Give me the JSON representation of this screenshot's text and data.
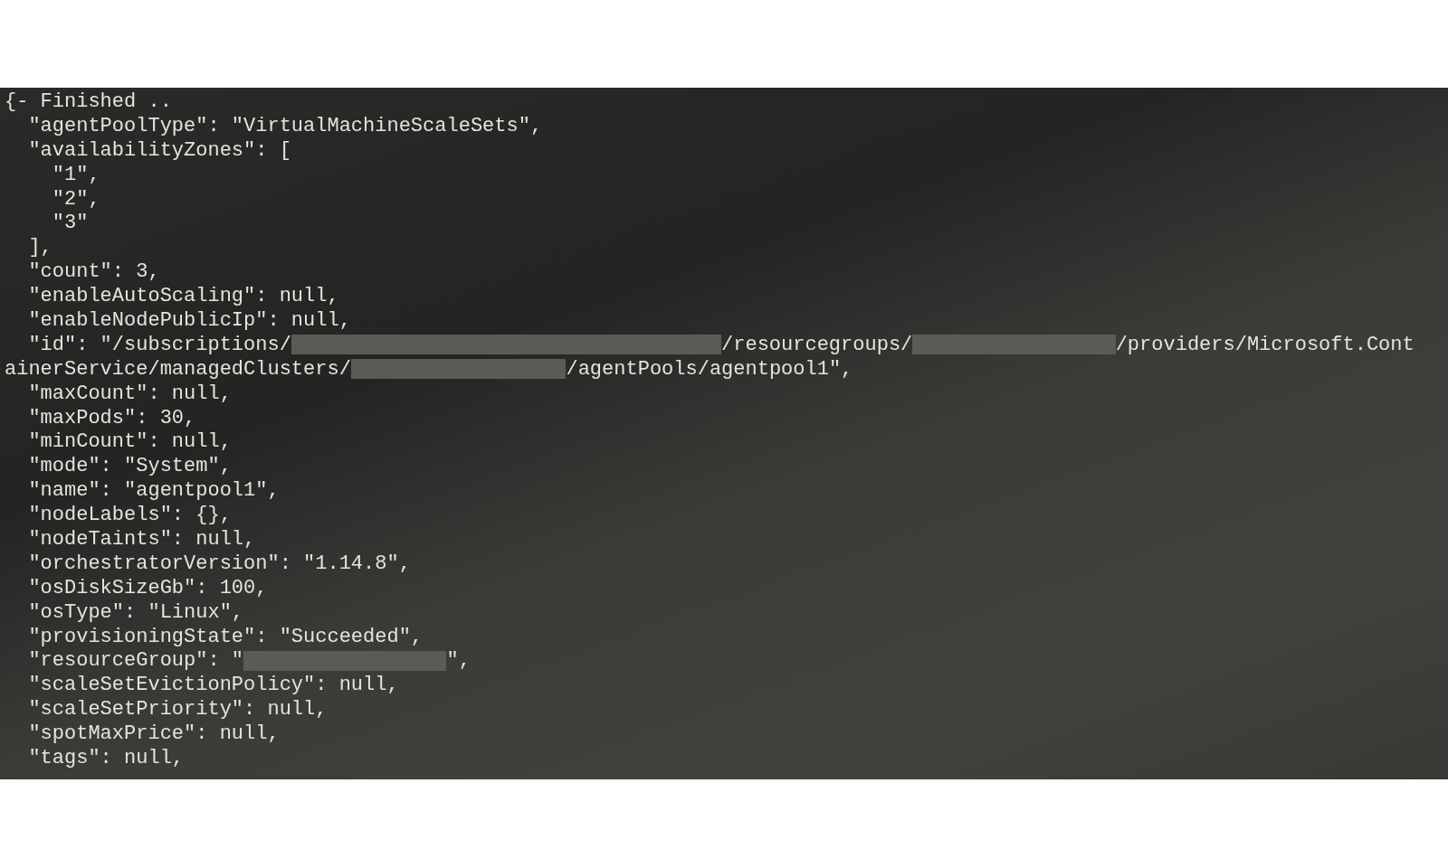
{
  "terminal": {
    "lines": [
      [
        {
          "kind": "text",
          "text": "{- Finished .."
        }
      ],
      [
        {
          "kind": "text",
          "text": "  \"agentPoolType\": \"VirtualMachineScaleSets\","
        }
      ],
      [
        {
          "kind": "text",
          "text": "  \"availabilityZones\": ["
        }
      ],
      [
        {
          "kind": "text",
          "text": "    \"1\","
        }
      ],
      [
        {
          "kind": "text",
          "text": "    \"2\","
        }
      ],
      [
        {
          "kind": "text",
          "text": "    \"3\""
        }
      ],
      [
        {
          "kind": "text",
          "text": "  ],"
        }
      ],
      [
        {
          "kind": "text",
          "text": "  \"count\": 3,"
        }
      ],
      [
        {
          "kind": "text",
          "text": "  \"enableAutoScaling\": null,"
        }
      ],
      [
        {
          "kind": "text",
          "text": "  \"enableNodePublicIp\": null,"
        }
      ],
      [
        {
          "kind": "text",
          "text": "  \"id\": \"/subscriptions/"
        },
        {
          "kind": "redacted"
        },
        {
          "kind": "text",
          "text": "/resourcegroups/"
        },
        {
          "kind": "redacted"
        },
        {
          "kind": "text",
          "text": "/providers/Microsoft.Cont"
        }
      ],
      [
        {
          "kind": "text",
          "text": "ainerService/managedClusters/"
        },
        {
          "kind": "redacted"
        },
        {
          "kind": "text",
          "text": "/agentPools/agentpool1\","
        }
      ],
      [
        {
          "kind": "text",
          "text": "  \"maxCount\": null,"
        }
      ],
      [
        {
          "kind": "text",
          "text": "  \"maxPods\": 30,"
        }
      ],
      [
        {
          "kind": "text",
          "text": "  \"minCount\": null,"
        }
      ],
      [
        {
          "kind": "text",
          "text": "  \"mode\": \"System\","
        }
      ],
      [
        {
          "kind": "text",
          "text": "  \"name\": \"agentpool1\","
        }
      ],
      [
        {
          "kind": "text",
          "text": "  \"nodeLabels\": {},"
        }
      ],
      [
        {
          "kind": "text",
          "text": "  \"nodeTaints\": null,"
        }
      ],
      [
        {
          "kind": "text",
          "text": "  \"orchestratorVersion\": \"1.14.8\","
        }
      ],
      [
        {
          "kind": "text",
          "text": "  \"osDiskSizeGb\": 100,"
        }
      ],
      [
        {
          "kind": "text",
          "text": "  \"osType\": \"Linux\","
        }
      ],
      [
        {
          "kind": "text",
          "text": "  \"provisioningState\": \"Succeeded\","
        }
      ],
      [
        {
          "kind": "text",
          "text": "  \"resourceGroup\": \""
        },
        {
          "kind": "redacted"
        },
        {
          "kind": "text",
          "text": "\","
        }
      ],
      [
        {
          "kind": "text",
          "text": "  \"scaleSetEvictionPolicy\": null,"
        }
      ],
      [
        {
          "kind": "text",
          "text": "  \"scaleSetPriority\": null,"
        }
      ],
      [
        {
          "kind": "text",
          "text": "  \"spotMaxPrice\": null,"
        }
      ],
      [
        {
          "kind": "text",
          "text": "  \"tags\": null,"
        }
      ]
    ]
  }
}
